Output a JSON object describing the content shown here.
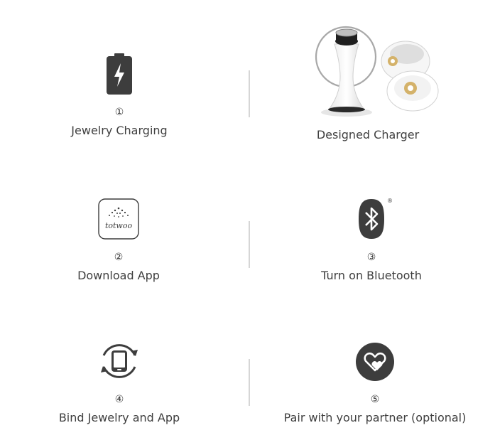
{
  "steps": [
    {
      "number": "①",
      "label": "Jewelry Charging",
      "icon": "battery-charging-icon"
    },
    {
      "number": "",
      "label": "Designed Charger",
      "icon": "charger-product-image"
    },
    {
      "number": "②",
      "label": "Download App",
      "icon": "totwoo-app-icon",
      "app_logo_text": "totwoo"
    },
    {
      "number": "③",
      "label": "Turn on Bluetooth",
      "icon": "bluetooth-icon",
      "trademark": "®"
    },
    {
      "number": "④",
      "label": "Bind Jewelry and App",
      "icon": "phone-sync-icon"
    },
    {
      "number": "⑤",
      "label": "Pair with your partner (optional)",
      "icon": "heart-pair-icon"
    }
  ],
  "colors": {
    "icon_dark": "#3d3d3d",
    "divider": "#d6d6d6",
    "text": "#3f3f3f"
  }
}
